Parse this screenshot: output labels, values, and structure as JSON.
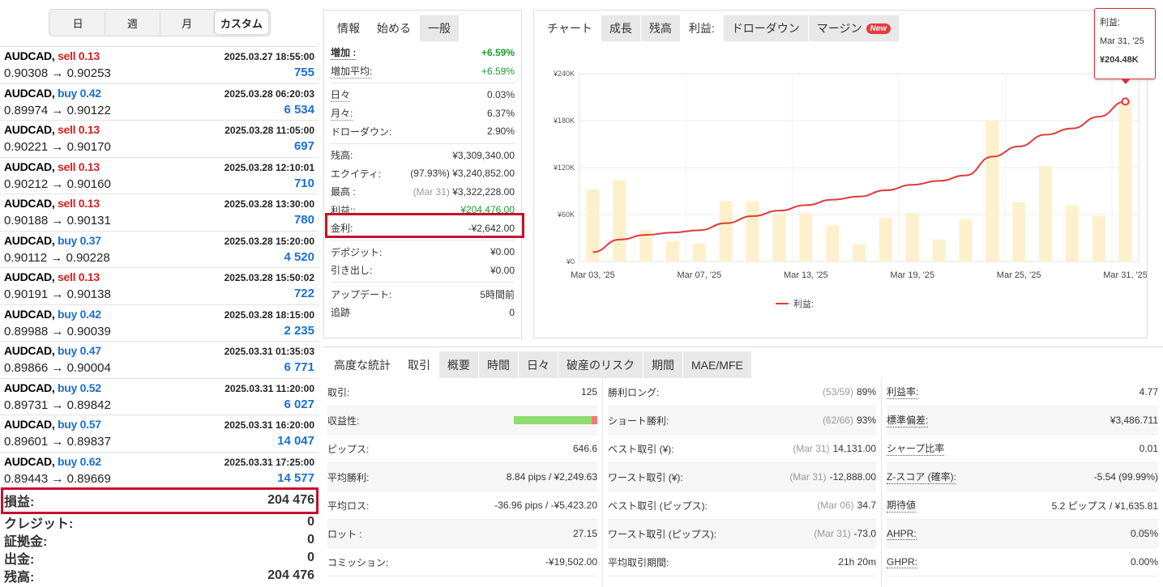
{
  "period_tabs": [
    {
      "label": "日",
      "active": false
    },
    {
      "label": "週",
      "active": false
    },
    {
      "label": "月",
      "active": false
    },
    {
      "label": "カスタム",
      "active": true
    }
  ],
  "trades": [
    {
      "symbol": "AUDCAD,",
      "side": "sell",
      "lots": "0.13",
      "time": "2025.03.27 18:55:00",
      "open": "0.90308",
      "close": "0.90253",
      "profit": "755"
    },
    {
      "symbol": "AUDCAD,",
      "side": "buy",
      "lots": "0.42",
      "time": "2025.03.28 06:20:03",
      "open": "0.89974",
      "close": "0.90122",
      "profit": "6 534"
    },
    {
      "symbol": "AUDCAD,",
      "side": "sell",
      "lots": "0.13",
      "time": "2025.03.28 11:05:00",
      "open": "0.90221",
      "close": "0.90170",
      "profit": "697"
    },
    {
      "symbol": "AUDCAD,",
      "side": "sell",
      "lots": "0.13",
      "time": "2025.03.28 12:10:01",
      "open": "0.90212",
      "close": "0.90160",
      "profit": "710"
    },
    {
      "symbol": "AUDCAD,",
      "side": "sell",
      "lots": "0.13",
      "time": "2025.03.28 13:30:00",
      "open": "0.90188",
      "close": "0.90131",
      "profit": "780"
    },
    {
      "symbol": "AUDCAD,",
      "side": "buy",
      "lots": "0.37",
      "time": "2025.03.28 15:20:00",
      "open": "0.90112",
      "close": "0.90228",
      "profit": "4 520"
    },
    {
      "symbol": "AUDCAD,",
      "side": "sell",
      "lots": "0.13",
      "time": "2025.03.28 15:50:02",
      "open": "0.90191",
      "close": "0.90138",
      "profit": "722"
    },
    {
      "symbol": "AUDCAD,",
      "side": "buy",
      "lots": "0.42",
      "time": "2025.03.28 18:15:00",
      "open": "0.89988",
      "close": "0.90039",
      "profit": "2 235"
    },
    {
      "symbol": "AUDCAD,",
      "side": "buy",
      "lots": "0.47",
      "time": "2025.03.31 01:35:03",
      "open": "0.89866",
      "close": "0.90004",
      "profit": "6 771"
    },
    {
      "symbol": "AUDCAD,",
      "side": "buy",
      "lots": "0.52",
      "time": "2025.03.31 11:20:00",
      "open": "0.89731",
      "close": "0.89842",
      "profit": "6 027"
    },
    {
      "symbol": "AUDCAD,",
      "side": "buy",
      "lots": "0.57",
      "time": "2025.03.31 16:20:00",
      "open": "0.89601",
      "close": "0.89837",
      "profit": "14 047"
    },
    {
      "symbol": "AUDCAD,",
      "side": "buy",
      "lots": "0.62",
      "time": "2025.03.31 17:25:00",
      "open": "0.89443",
      "close": "0.89669",
      "profit": "14 577"
    }
  ],
  "arrow": "→",
  "summary": [
    {
      "label": "損益:",
      "value": "204 476"
    },
    {
      "label": "クレジット:",
      "value": "0"
    },
    {
      "label": "証拠金:",
      "value": "0"
    },
    {
      "label": "出金:",
      "value": "0"
    },
    {
      "label": "残高:",
      "value": "204 476"
    }
  ],
  "stats_tabs": [
    {
      "label": "情報",
      "active": false
    },
    {
      "label": "始める",
      "active": true
    },
    {
      "label": "一般",
      "active": false
    }
  ],
  "stats_groups": [
    [
      {
        "label": "増加 :",
        "value": "+6.59%",
        "style": "bold-pos"
      },
      {
        "label": "増加平均:",
        "value": "+6.59%",
        "style": "posn"
      }
    ],
    [
      {
        "label": "日々",
        "value": "0.03%",
        "style": ""
      },
      {
        "label": "月々:",
        "value": "6.37%",
        "style": ""
      },
      {
        "label": "ドローダウン:",
        "value": "2.90%",
        "style": "nodot"
      }
    ],
    [
      {
        "label": "残高:",
        "value": "¥3,309,340.00",
        "style": "nodot"
      },
      {
        "label": "エクイティ:",
        "value": "¥3,240,852.00",
        "pre": "(97.93%)",
        "style": "nodot"
      },
      {
        "label": "最高 :",
        "value": "¥3,322,228.00",
        "pre": "(Mar 31)",
        "style": "nodot-muted"
      },
      {
        "label": "利益::",
        "value": "¥204,476.00",
        "style": "nodot-posn"
      },
      {
        "label": "金利:",
        "value": "-¥2,642.00",
        "style": "nodot"
      }
    ],
    [
      {
        "label": "デポジット:",
        "value": "¥0.00",
        "style": "nodot"
      },
      {
        "label": "引き出し:",
        "value": "¥0.00",
        "style": "nodot"
      }
    ],
    [
      {
        "label": "アップデート:",
        "value": "5時間前",
        "style": "nodot"
      },
      {
        "label": "追跡",
        "value": "0",
        "style": "nodot"
      }
    ]
  ],
  "chart_tabs": [
    {
      "label": "チャート",
      "active": false,
      "plain": true
    },
    {
      "label": "成長",
      "active": false
    },
    {
      "label": "残高",
      "active": false
    },
    {
      "label": "利益:",
      "active": true
    },
    {
      "label": "ドローダウン",
      "active": false
    },
    {
      "label": "マージン",
      "active": false,
      "badge": "New"
    }
  ],
  "chart_data": {
    "type": "line",
    "x": [
      "Mar 03, '25",
      "Mar 04, '25",
      "Mar 05, '25",
      "Mar 06, '25",
      "Mar 07, '25",
      "Mar 10, '25",
      "Mar 11, '25",
      "Mar 12, '25",
      "Mar 13, '25",
      "Mar 14, '25",
      "Mar 17, '25",
      "Mar 18, '25",
      "Mar 19, '25",
      "Mar 20, '25",
      "Mar 21, '25",
      "Mar 24, '25",
      "Mar 25, '25",
      "Mar 26, '25",
      "Mar 27, '25",
      "Mar 28, '25",
      "Mar 31, '25"
    ],
    "x_tick_labels": [
      "Mar 03, '25",
      "Mar 07, '25",
      "Mar 13, '25",
      "Mar 19, '25",
      "Mar 25, '25",
      "Mar 31, '25"
    ],
    "x_tick_index": [
      0,
      4,
      8,
      12,
      16,
      20
    ],
    "series": [
      {
        "name": "利益:",
        "color": "#e03a3a",
        "values": [
          12,
          28,
          34,
          37,
          40,
          49,
          58,
          65,
          72,
          79,
          83,
          91,
          98,
          103,
          110,
          134,
          147,
          162,
          170,
          185,
          204.48
        ]
      },
      {
        "color": "#fdf0cc",
        "values": [
          92,
          104,
          40,
          26,
          23,
          77,
          77,
          60,
          62,
          46,
          22,
          56,
          62,
          28,
          54,
          180,
          76,
          122,
          72,
          58,
          205
        ]
      }
    ],
    "ylim": [
      0,
      240
    ],
    "y_ticks": [
      0,
      60,
      120,
      180,
      240
    ],
    "y_tick_labels": [
      "¥0",
      "¥60K",
      "¥120K",
      "¥180K",
      "¥240K"
    ],
    "grid": true,
    "legend": "bottom-center"
  },
  "tooltip": {
    "label": "利益:",
    "date": "Mar 31, '25",
    "value": "¥204.48K"
  },
  "adv_tabs": [
    {
      "label": "高度な統計",
      "active": false,
      "plain": true
    },
    {
      "label": "取引",
      "active": true
    },
    {
      "label": "概要",
      "active": false
    },
    {
      "label": "時間",
      "active": false
    },
    {
      "label": "日々",
      "active": false
    },
    {
      "label": "破産のリスク",
      "active": false
    },
    {
      "label": "期間",
      "active": false
    },
    {
      "label": "MAE/MFE",
      "active": false
    }
  ],
  "adv_col1": [
    {
      "label": "取引:",
      "value": "125"
    },
    {
      "label": "収益性:",
      "value": "",
      "bar": 0.93
    },
    {
      "label": "ピップス:",
      "value": "646.6"
    },
    {
      "label": "平均勝利:",
      "value": "8.84 pips / ¥2,249.63"
    },
    {
      "label": "平均ロス:",
      "value": "-36.96 pips / -¥5,423.20"
    },
    {
      "label": "ロット :",
      "value": "27.15"
    },
    {
      "label": "コミッション:",
      "value": "-¥19,502.00"
    }
  ],
  "adv_col2": [
    {
      "label": "勝利ロング:",
      "pre": "(53/59)",
      "value": "89%"
    },
    {
      "label": "ショート勝利:",
      "pre": "(62/66)",
      "value": "93%"
    },
    {
      "label": "ベスト取引 (¥):",
      "pre": "(Mar 31)",
      "value": "14,131.00"
    },
    {
      "label": "ワースト取引 (¥):",
      "pre": "(Mar 31)",
      "value": "-12,888.00"
    },
    {
      "label": "ベスト取引 (ピップス):",
      "pre": "(Mar 06)",
      "value": "34.7"
    },
    {
      "label": "ワースト取引 (ピップス):",
      "pre": "(Mar 31)",
      "value": "-73.0"
    },
    {
      "label": "平均取引期間:",
      "pre": "",
      "value": "21h 20m"
    }
  ],
  "adv_col3": [
    {
      "label": "利益率:",
      "value": "4.77"
    },
    {
      "label": "標準偏差:",
      "value": "¥3,486.711"
    },
    {
      "label": "シャープ比率",
      "value": "0.01"
    },
    {
      "label": "Z-スコア (確率):",
      "value": "-5.54 (99.99%)"
    },
    {
      "label": "期待値",
      "value": "5.2 ピップス / ¥1,635.81"
    },
    {
      "label": "AHPR:",
      "value": "0.05%"
    },
    {
      "label": "GHPR:",
      "value": "0.00%"
    }
  ]
}
